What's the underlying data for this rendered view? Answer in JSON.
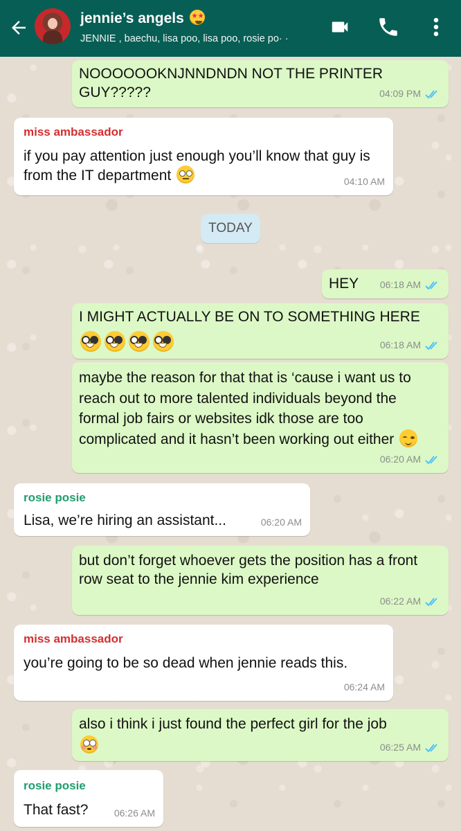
{
  "header": {
    "title": "jennie’s angels",
    "title_emoji": "star-struck",
    "members": "JENNIE , baechu, lisa poo, lisa poo, rosie po· ·",
    "background": "#075e54"
  },
  "date_divider": "TODAY",
  "messages": [
    {
      "direction": "out",
      "text": "NOOOOOOKNJNNDNDN NOT THE PRINTER GUY?????",
      "time": "04:09 PM",
      "read": true
    },
    {
      "direction": "in",
      "sender": "miss ambassador",
      "sender_color": "#d32f2f",
      "text": "if you pay attention just enough you’ll know that guy is from the IT department",
      "emoji": "face-with-rolling-eyes",
      "time": "04:10 AM"
    },
    {
      "direction": "out",
      "text": "HEY",
      "time": "06:18 AM",
      "read": true
    },
    {
      "direction": "out",
      "text": "I MIGHT ACTUALLY BE ON TO SOMETHING HERE",
      "emoji": "nerd-face x4",
      "time": "06:18 AM",
      "read": true
    },
    {
      "direction": "out",
      "text": "maybe the reason for that that is ‘cause i want us to reach out to more talented individuals beyond the formal job fairs or websites idk those are too complicated and it hasn’t been working out either",
      "emoji": "relieved-face",
      "time": "06:20 AM",
      "read": true
    },
    {
      "direction": "in",
      "sender": "rosie posie",
      "sender_color": "#1f9d6e",
      "text": "Lisa, we’re hiring an assistant...",
      "time": "06:20 AM"
    },
    {
      "direction": "out",
      "text": "but don’t forget whoever gets the position has a front row seat to the jennie kim experience",
      "time": "06:22 AM",
      "read": true
    },
    {
      "direction": "in",
      "sender": "miss ambassador",
      "sender_color": "#d32f2f",
      "text": "you’re going to be so dead when jennie reads this.",
      "time": "06:24 AM"
    },
    {
      "direction": "out",
      "text": "also i think i just found the perfect girl for the job",
      "emoji": "flushed-face",
      "time": "06:25 AM",
      "read": true
    },
    {
      "direction": "in",
      "sender": "rosie posie",
      "sender_color": "#1f9d6e",
      "text": "That fast?",
      "time": "06:26 AM"
    }
  ],
  "colors": {
    "outgoing_bubble": "#dcf8c6",
    "incoming_bubble": "#ffffff",
    "read_ticks": "#4fc3f7",
    "wallpaper": "#e6ddd2"
  }
}
